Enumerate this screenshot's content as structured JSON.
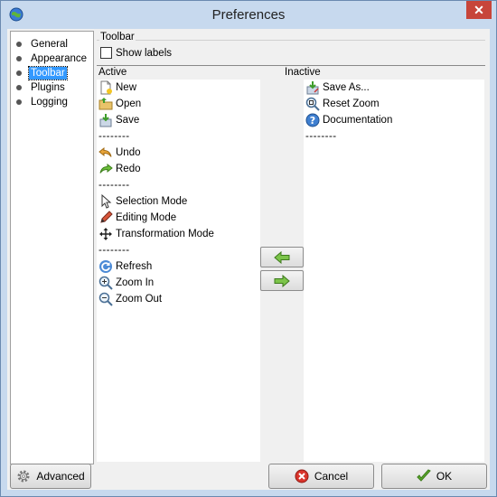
{
  "window": {
    "title": "Preferences",
    "close_glyph": "✕"
  },
  "nav": {
    "items": [
      {
        "label": "General",
        "selected": false
      },
      {
        "label": "Appearance",
        "selected": false
      },
      {
        "label": "Toolbar",
        "selected": true
      },
      {
        "label": "Plugins",
        "selected": false
      },
      {
        "label": "Logging",
        "selected": false
      }
    ]
  },
  "toolbar_panel": {
    "group_title": "Toolbar",
    "show_labels": {
      "label": "Show labels",
      "checked": false
    },
    "active_header": "Active",
    "inactive_header": "Inactive",
    "separator_text": "--------",
    "active_items": [
      {
        "label": "New",
        "icon": "new-document-icon"
      },
      {
        "label": "Open",
        "icon": "open-folder-icon"
      },
      {
        "label": "Save",
        "icon": "save-icon"
      },
      {
        "separator": true
      },
      {
        "label": "Undo",
        "icon": "undo-icon"
      },
      {
        "label": "Redo",
        "icon": "redo-icon"
      },
      {
        "separator": true
      },
      {
        "label": "Selection Mode",
        "icon": "cursor-icon"
      },
      {
        "label": "Editing Mode",
        "icon": "pencil-icon"
      },
      {
        "label": "Transformation Mode",
        "icon": "move-icon"
      },
      {
        "separator": true
      },
      {
        "label": "Refresh",
        "icon": "refresh-icon"
      },
      {
        "label": "Zoom In",
        "icon": "zoom-in-icon"
      },
      {
        "label": "Zoom Out",
        "icon": "zoom-out-icon"
      }
    ],
    "inactive_items": [
      {
        "label": "Save As...",
        "icon": "save-as-icon"
      },
      {
        "label": "Reset Zoom",
        "icon": "reset-zoom-icon"
      },
      {
        "label": "Documentation",
        "icon": "help-icon"
      },
      {
        "separator": true
      }
    ]
  },
  "buttons": {
    "advanced": "Advanced",
    "cancel": "Cancel",
    "ok": "OK"
  },
  "colors": {
    "selection": "#3399ff",
    "titlebar": "#c7d9ee",
    "close": "#c7453a",
    "arrow_green": "#5fae2e"
  }
}
